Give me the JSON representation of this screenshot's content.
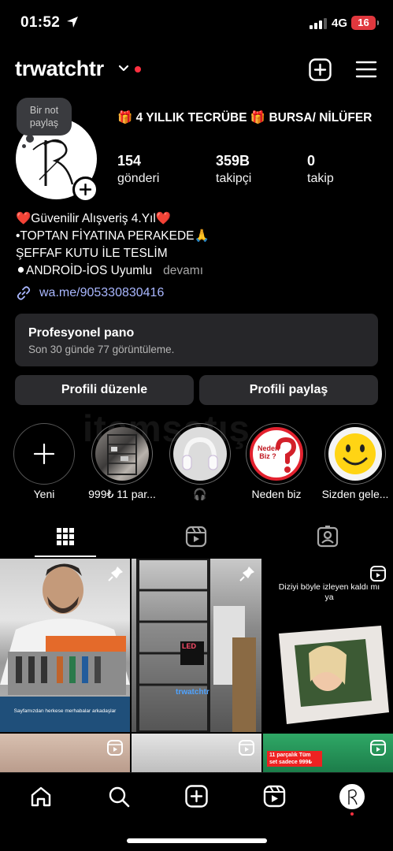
{
  "status_bar": {
    "time": "01:52",
    "network": "4G",
    "battery": "16"
  },
  "header": {
    "username": "trwatchtr"
  },
  "note": {
    "text": "Bir not paylaş"
  },
  "profile": {
    "category": "🎁 4 YILLIK TECRÜBE 🎁 BURSA/ NİLÜFER",
    "stats": [
      {
        "value": "154",
        "label": "gönderi"
      },
      {
        "value": "359B",
        "label": "takipçi"
      },
      {
        "value": "0",
        "label": "takip"
      }
    ],
    "bio": [
      "❤️Güvenilir Alışveriş 4.Yıl❤️",
      "•TOPTAN FİYATINA PERAKEDE🙏",
      "ŞEFFAF KUTU İLE TESLİM",
      "⚫ANDROİD-İOS Uyumlu"
    ],
    "more": "devamı",
    "link": "wa.me/905330830416"
  },
  "dashboard": {
    "title": "Profesyonel pano",
    "subtitle": "Son 30 günde 77 görüntüleme."
  },
  "buttons": {
    "edit": "Profili düzenle",
    "share": "Profili paylaş"
  },
  "watermark": "itemsatış",
  "highlights": [
    {
      "label": "Yeni"
    },
    {
      "label": "999₺ 11 par..."
    },
    {
      "label": "🎧"
    },
    {
      "label": "Neden biz"
    },
    {
      "label": "Sizden gele..."
    }
  ],
  "highlight_badge": "Neden Biz ?",
  "grid": {
    "post1_caption": "Sayfamızdan herkese merhabalar arkadaşlar",
    "post2_sign": "LED",
    "post2_watermark": "trwatchtr",
    "post3_caption": "Diziyi böyle izleyen kaldı mı ya",
    "post6_caption": "11 parçalık Tüm set sadece 999₺"
  },
  "colors": {
    "accent_link": "#a9b7ff",
    "notification": "#ff3040",
    "battery": "#e0383e",
    "surface": "#262629"
  }
}
